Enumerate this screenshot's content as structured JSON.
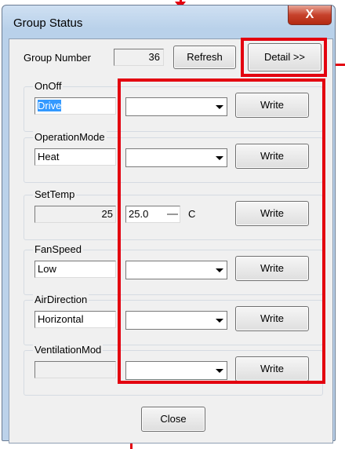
{
  "window": {
    "title": "Group Status",
    "close_glyph": "X"
  },
  "group_number": {
    "label": "Group Number",
    "value": "36"
  },
  "buttons": {
    "refresh": "Refresh",
    "detail": "Detail >>",
    "close": "Close"
  },
  "settings": [
    {
      "legend": "OnOff",
      "value": "Drive",
      "write": "Write"
    },
    {
      "legend": "OperationMode",
      "value": "Heat",
      "write": "Write"
    },
    {
      "legend": "SetTemp",
      "value": "25",
      "write": "Write",
      "spin_value": "25.0",
      "unit": "C"
    },
    {
      "legend": "FanSpeed",
      "value": "Low",
      "write": "Write"
    },
    {
      "legend": "AirDirection",
      "value": "Horizontal",
      "write": "Write"
    },
    {
      "legend": "VentilationMod",
      "value": "",
      "write": "Write"
    }
  ],
  "colors": {
    "highlight": "#e3000f"
  },
  "icons": [
    "close-icon",
    "dropdown-arrow-icon",
    "spin-up-icon",
    "spin-down-icon"
  ]
}
